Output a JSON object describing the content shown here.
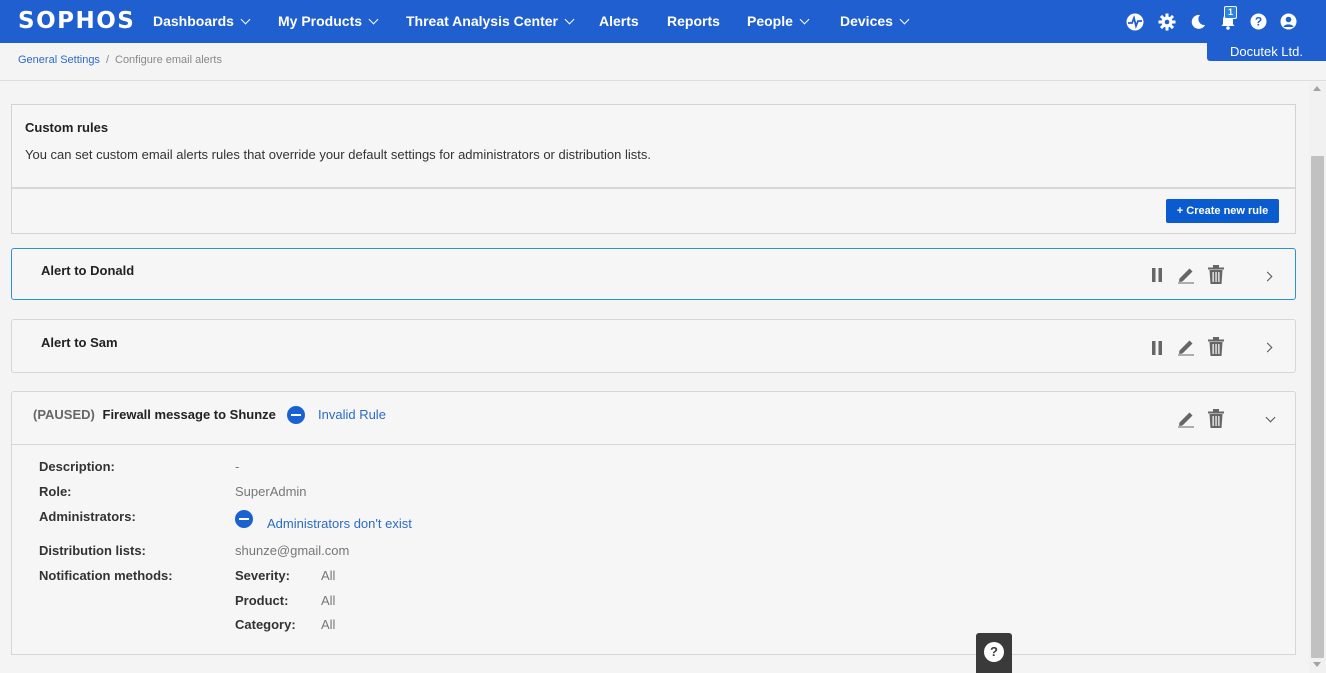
{
  "brand": {
    "logo": "SOPHOS",
    "primary_color": "#1f5fcf",
    "link_color": "#2b6bc8",
    "button_color": "#0a5bd0"
  },
  "nav": {
    "items": [
      {
        "label": "Dashboards",
        "dropdown": true
      },
      {
        "label": "My Products",
        "dropdown": true
      },
      {
        "label": "Threat Analysis Center",
        "dropdown": true
      },
      {
        "label": "Alerts",
        "dropdown": false
      },
      {
        "label": "Reports",
        "dropdown": false
      },
      {
        "label": "People",
        "dropdown": true
      },
      {
        "label": "Devices",
        "dropdown": true
      }
    ],
    "icons": [
      "pulse-icon",
      "gear-icon",
      "moon-icon",
      "bell-icon",
      "help-icon",
      "user-icon"
    ],
    "notification_count": "1",
    "tenant": "Docutek Ltd."
  },
  "breadcrumb": {
    "parent": "General Settings",
    "separator": "/",
    "current": "Configure email alerts"
  },
  "custom_rules": {
    "title": "Custom rules",
    "description": "You can set custom email alerts rules that override your default settings for administrators or distribution lists.",
    "create_button": "+ Create new rule"
  },
  "rules": [
    {
      "name": "Alert to Donald",
      "selected": true
    },
    {
      "name": "Alert to Sam",
      "selected": false
    },
    {
      "status": "(PAUSED)",
      "name": "Firewall message to Shunze",
      "invalid_label": "Invalid Rule",
      "expanded": true
    }
  ],
  "details": {
    "description_label": "Description:",
    "description_value": "-",
    "role_label": "Role:",
    "role_value": "SuperAdmin",
    "admins_label": "Administrators:",
    "admins_value": "Administrators don't exist",
    "dist_label": "Distribution lists:",
    "dist_value": "shunze@gmail.com",
    "notif_label": "Notification methods:",
    "severity_label": "Severity:",
    "severity_value": "All",
    "product_label": "Product:",
    "product_value": "All",
    "category_label": "Category:",
    "category_value": "All"
  },
  "help": {
    "glyph": "?"
  }
}
